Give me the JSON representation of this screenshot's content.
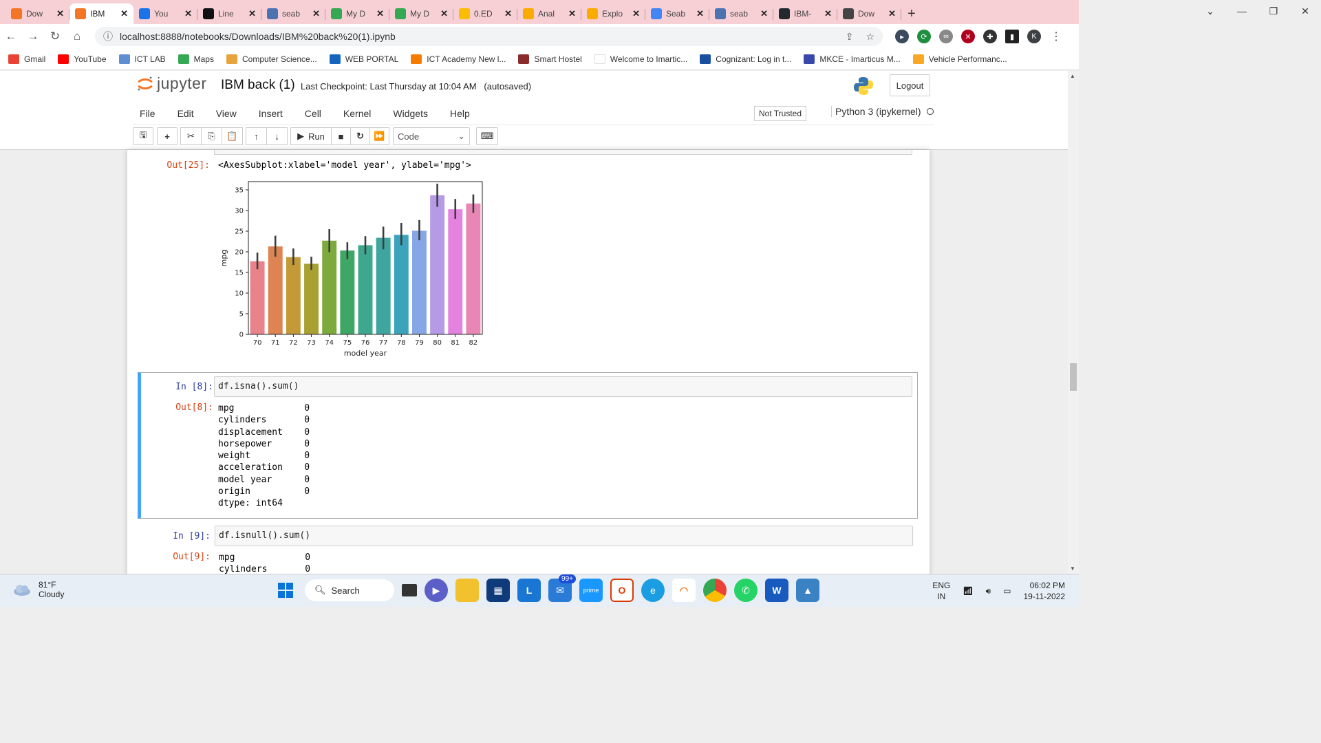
{
  "browser": {
    "tabs": [
      {
        "label": "Dow",
        "color": "#f37626"
      },
      {
        "label": "IBM",
        "color": "#f37626",
        "active": true
      },
      {
        "label": "You",
        "color": "#1a73e8"
      },
      {
        "label": "Line",
        "color": "#111"
      },
      {
        "label": "seab",
        "color": "#4c72b0"
      },
      {
        "label": "My D",
        "color": "#34a853"
      },
      {
        "label": "My D",
        "color": "#34a853"
      },
      {
        "label": "0.ED",
        "color": "#fbbc04"
      },
      {
        "label": "Anal",
        "color": "#f9ab00"
      },
      {
        "label": "Explo",
        "color": "#f9ab00"
      },
      {
        "label": "Seab",
        "color": "#4285f4"
      },
      {
        "label": "seab",
        "color": "#4c72b0"
      },
      {
        "label": "IBM-",
        "color": "#24292f"
      },
      {
        "label": "Dow",
        "color": "#444"
      }
    ],
    "url": "localhost:8888/notebooks/Downloads/IBM%20back%20(1).ipynb",
    "profile_initial": "K",
    "bookmarks": [
      {
        "label": "Gmail",
        "color": "#ea4335"
      },
      {
        "label": "YouTube",
        "color": "#ff0000"
      },
      {
        "label": "ICT LAB",
        "color": "#5f8fd0"
      },
      {
        "label": "Maps",
        "color": "#34a853"
      },
      {
        "label": "Computer Science...",
        "color": "#e8a33d"
      },
      {
        "label": "WEB PORTAL",
        "color": "#1565c0"
      },
      {
        "label": "ICT Academy New l...",
        "color": "#f57c00"
      },
      {
        "label": "Smart Hostel",
        "color": "#8b2c2c"
      },
      {
        "label": "Welcome to Imartic...",
        "color": "#ffffff"
      },
      {
        "label": "Cognizant: Log in t...",
        "color": "#1a4fa0"
      },
      {
        "label": "MKCE - Imarticus M...",
        "color": "#3949ab"
      },
      {
        "label": "Vehicle Performanc...",
        "color": "#f9a825"
      }
    ]
  },
  "jupyter": {
    "logo_text": "jupyter",
    "notebook_name": "IBM back (1)",
    "checkpoint": "Last Checkpoint: Last Thursday at 10:04 AM",
    "autosave": "(autosaved)",
    "logout": "Logout",
    "menu": [
      "File",
      "Edit",
      "View",
      "Insert",
      "Cell",
      "Kernel",
      "Widgets",
      "Help"
    ],
    "trust": "Not Trusted",
    "kernel": "Python 3 (ipykernel)",
    "run_label": "Run",
    "cell_type": "Code"
  },
  "cells": {
    "c25": {
      "out_prompt": "Out[25]:",
      "out_text": "<AxesSubplot:xlabel='model year', ylabel='mpg'>"
    },
    "c8": {
      "in_prompt": "In [8]:",
      "code": "df.isna().sum()",
      "out_prompt": "Out[8]:",
      "out_text": "mpg             0\ncylinders       0\ndisplacement    0\nhorsepower      0\nweight          0\nacceleration    0\nmodel year      0\norigin          0\ndtype: int64"
    },
    "c9": {
      "in_prompt": "In [9]:",
      "code": "df.isnull().sum()",
      "out_prompt": "Out[9]:",
      "out_text": "mpg             0\ncylinders       0"
    }
  },
  "chart_data": {
    "type": "bar",
    "xlabel": "model year",
    "ylabel": "mpg",
    "categories": [
      "70",
      "71",
      "72",
      "73",
      "74",
      "75",
      "76",
      "77",
      "78",
      "79",
      "80",
      "81",
      "82"
    ],
    "values": [
      17.7,
      21.3,
      18.7,
      17.1,
      22.7,
      20.3,
      21.6,
      23.4,
      24.1,
      25.1,
      33.7,
      30.3,
      31.7
    ],
    "error_low": [
      15.8,
      18.8,
      16.8,
      15.6,
      19.9,
      18.2,
      19.4,
      20.6,
      21.6,
      22.8,
      30.9,
      28.0,
      29.4
    ],
    "error_high": [
      19.8,
      23.9,
      20.8,
      18.8,
      25.5,
      22.3,
      23.8,
      26.1,
      27.0,
      27.7,
      36.5,
      32.8,
      33.9
    ],
    "colors": [
      "#e8828b",
      "#dd8452",
      "#c49a38",
      "#a9a032",
      "#7daa3d",
      "#3ea765",
      "#3ea88e",
      "#3ea69f",
      "#3ba3bc",
      "#86a6e6",
      "#b59ae6",
      "#e382df",
      "#e887b6"
    ],
    "ylim": [
      0,
      37
    ],
    "yticks": [
      0,
      5,
      10,
      15,
      20,
      25,
      30,
      35
    ]
  },
  "taskbar": {
    "temp": "81°F",
    "weather": "Cloudy",
    "search": "Search",
    "badge": "99+",
    "lang1": "ENG",
    "lang2": "IN",
    "time": "06:02 PM",
    "date": "19-11-2022"
  }
}
